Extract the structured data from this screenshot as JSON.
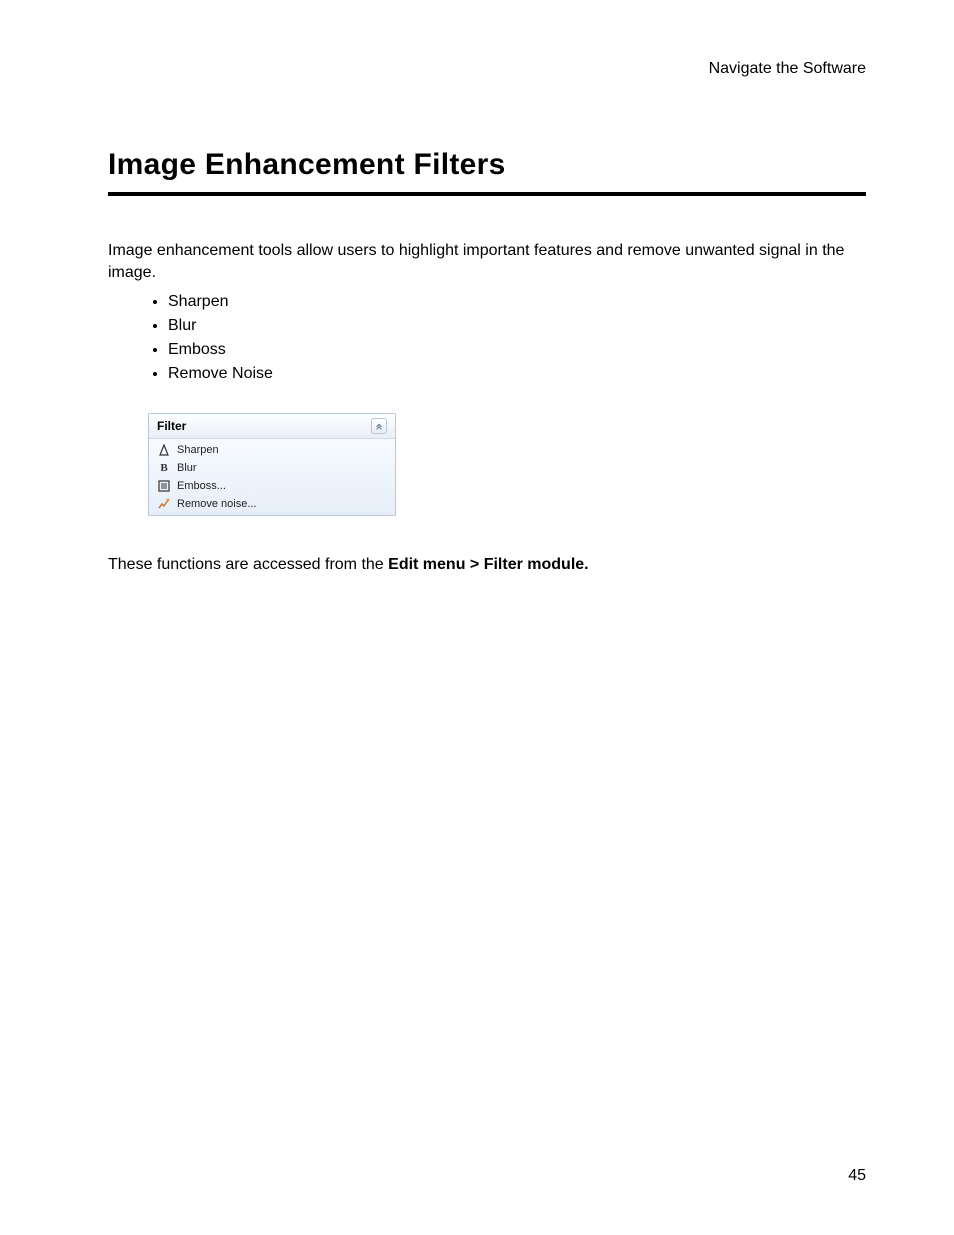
{
  "header": {
    "breadcrumb": "Navigate the Software"
  },
  "title": "Image Enhancement Filters",
  "intro": "Image enhancement tools allow users to highlight important features and remove unwanted signal in the image.",
  "bullets": [
    "Sharpen",
    "Blur",
    "Emboss",
    "Remove Noise"
  ],
  "panel": {
    "title": "Filter",
    "items": [
      {
        "icon": "sharpen-icon",
        "label": "Sharpen"
      },
      {
        "icon": "blur-icon",
        "label": "Blur"
      },
      {
        "icon": "emboss-icon",
        "label": "Emboss..."
      },
      {
        "icon": "noise-icon",
        "label": "Remove noise..."
      }
    ]
  },
  "footer": {
    "prefix": "These functions are accessed from the ",
    "bold": "Edit menu > Filter module."
  },
  "page_number": "45"
}
